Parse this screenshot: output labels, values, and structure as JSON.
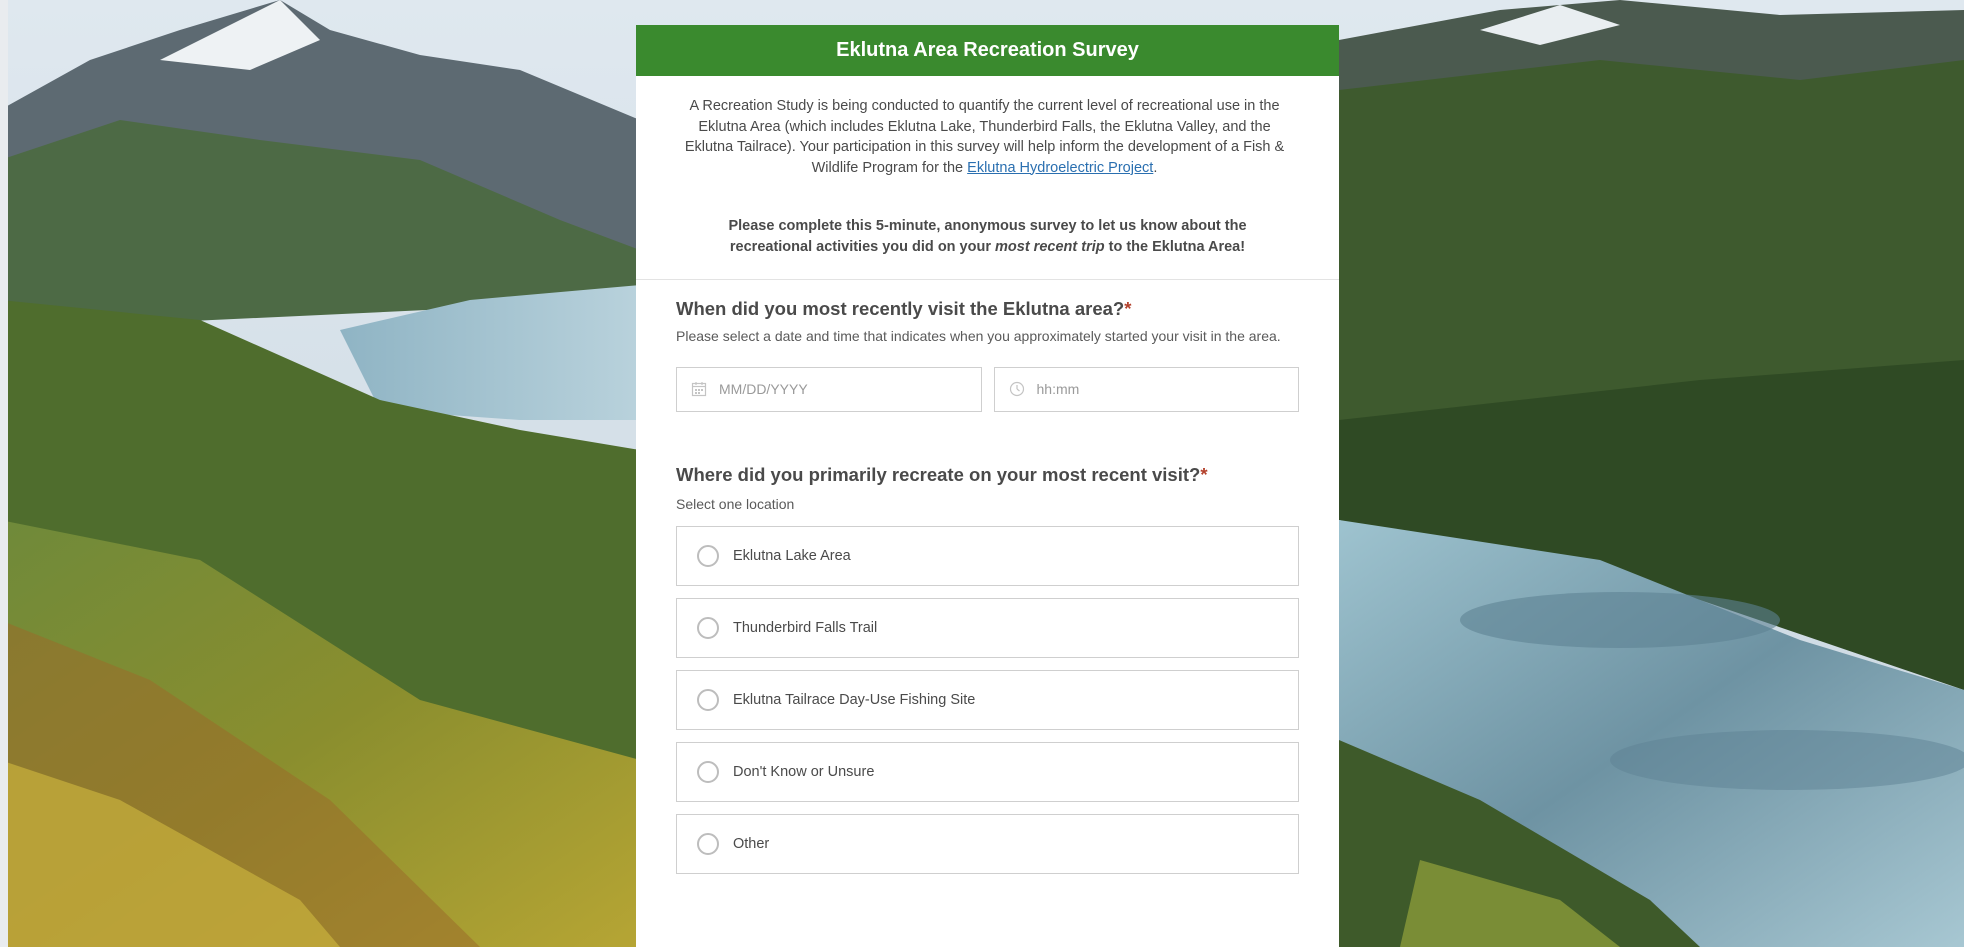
{
  "survey": {
    "title": "Eklutna Area Recreation Survey",
    "intro_text": "A Recreation Study is being conducted to quantify the current level of recreational use in the Eklutna Area (which includes Eklutna Lake, Thunderbird Falls, the Eklutna Valley, and the Eklutna Tailrace). Your participation in this survey will help inform the development of a Fish & Wildlife Program for the ",
    "intro_link": "Eklutna Hydroelectric Project",
    "intro_end": ".",
    "intro2_a": "Please complete this 5-minute, anonymous survey to let us know about the recreational activities you did on your ",
    "intro2_em": "most recent trip",
    "intro2_b": " to the Eklutna Area!"
  },
  "q1": {
    "title": "When did you most recently visit the Eklutna area?",
    "required_mark": "*",
    "description": "Please select a date and time that indicates when you approximately started your visit in the area.",
    "date_placeholder": "MM/DD/YYYY",
    "time_placeholder": "hh:mm",
    "date_value": "",
    "time_value": ""
  },
  "q2": {
    "title": "Where did you primarily recreate on your most recent visit?",
    "required_mark": "*",
    "description": "Select one location",
    "options": [
      {
        "label": "Eklutna Lake Area"
      },
      {
        "label": "Thunderbird Falls Trail"
      },
      {
        "label": "Eklutna Tailrace Day-Use Fishing Site"
      },
      {
        "label": "Don't Know or Unsure"
      },
      {
        "label": "Other"
      }
    ]
  },
  "colors": {
    "header_bg": "#3a8a2e",
    "link": "#2a6fb0",
    "required": "#b3402b"
  },
  "icons": {
    "date": "calendar-icon",
    "time": "clock-icon",
    "background": "mountain-lake-landscape"
  }
}
